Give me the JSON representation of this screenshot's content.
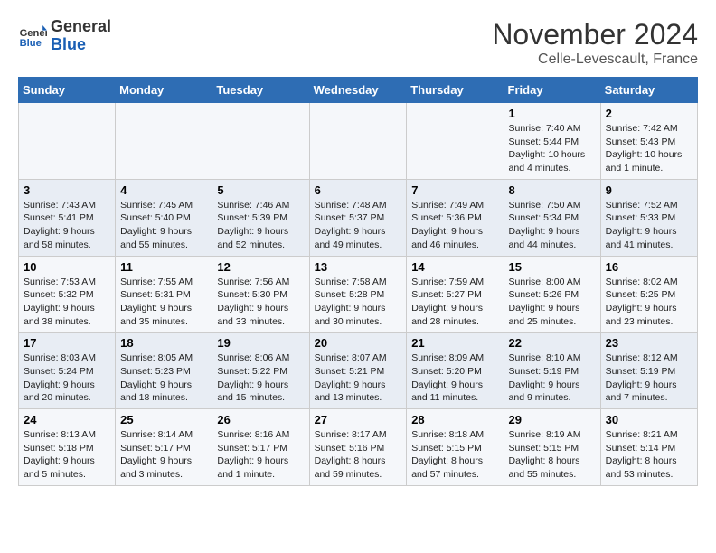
{
  "logo": {
    "text_general": "General",
    "text_blue": "Blue"
  },
  "title": "November 2024",
  "subtitle": "Celle-Levescault, France",
  "weekdays": [
    "Sunday",
    "Monday",
    "Tuesday",
    "Wednesday",
    "Thursday",
    "Friday",
    "Saturday"
  ],
  "weeks": [
    [
      {
        "day": "",
        "info": ""
      },
      {
        "day": "",
        "info": ""
      },
      {
        "day": "",
        "info": ""
      },
      {
        "day": "",
        "info": ""
      },
      {
        "day": "",
        "info": ""
      },
      {
        "day": "1",
        "info": "Sunrise: 7:40 AM\nSunset: 5:44 PM\nDaylight: 10 hours and 4 minutes."
      },
      {
        "day": "2",
        "info": "Sunrise: 7:42 AM\nSunset: 5:43 PM\nDaylight: 10 hours and 1 minute."
      }
    ],
    [
      {
        "day": "3",
        "info": "Sunrise: 7:43 AM\nSunset: 5:41 PM\nDaylight: 9 hours and 58 minutes."
      },
      {
        "day": "4",
        "info": "Sunrise: 7:45 AM\nSunset: 5:40 PM\nDaylight: 9 hours and 55 minutes."
      },
      {
        "day": "5",
        "info": "Sunrise: 7:46 AM\nSunset: 5:39 PM\nDaylight: 9 hours and 52 minutes."
      },
      {
        "day": "6",
        "info": "Sunrise: 7:48 AM\nSunset: 5:37 PM\nDaylight: 9 hours and 49 minutes."
      },
      {
        "day": "7",
        "info": "Sunrise: 7:49 AM\nSunset: 5:36 PM\nDaylight: 9 hours and 46 minutes."
      },
      {
        "day": "8",
        "info": "Sunrise: 7:50 AM\nSunset: 5:34 PM\nDaylight: 9 hours and 44 minutes."
      },
      {
        "day": "9",
        "info": "Sunrise: 7:52 AM\nSunset: 5:33 PM\nDaylight: 9 hours and 41 minutes."
      }
    ],
    [
      {
        "day": "10",
        "info": "Sunrise: 7:53 AM\nSunset: 5:32 PM\nDaylight: 9 hours and 38 minutes."
      },
      {
        "day": "11",
        "info": "Sunrise: 7:55 AM\nSunset: 5:31 PM\nDaylight: 9 hours and 35 minutes."
      },
      {
        "day": "12",
        "info": "Sunrise: 7:56 AM\nSunset: 5:30 PM\nDaylight: 9 hours and 33 minutes."
      },
      {
        "day": "13",
        "info": "Sunrise: 7:58 AM\nSunset: 5:28 PM\nDaylight: 9 hours and 30 minutes."
      },
      {
        "day": "14",
        "info": "Sunrise: 7:59 AM\nSunset: 5:27 PM\nDaylight: 9 hours and 28 minutes."
      },
      {
        "day": "15",
        "info": "Sunrise: 8:00 AM\nSunset: 5:26 PM\nDaylight: 9 hours and 25 minutes."
      },
      {
        "day": "16",
        "info": "Sunrise: 8:02 AM\nSunset: 5:25 PM\nDaylight: 9 hours and 23 minutes."
      }
    ],
    [
      {
        "day": "17",
        "info": "Sunrise: 8:03 AM\nSunset: 5:24 PM\nDaylight: 9 hours and 20 minutes."
      },
      {
        "day": "18",
        "info": "Sunrise: 8:05 AM\nSunset: 5:23 PM\nDaylight: 9 hours and 18 minutes."
      },
      {
        "day": "19",
        "info": "Sunrise: 8:06 AM\nSunset: 5:22 PM\nDaylight: 9 hours and 15 minutes."
      },
      {
        "day": "20",
        "info": "Sunrise: 8:07 AM\nSunset: 5:21 PM\nDaylight: 9 hours and 13 minutes."
      },
      {
        "day": "21",
        "info": "Sunrise: 8:09 AM\nSunset: 5:20 PM\nDaylight: 9 hours and 11 minutes."
      },
      {
        "day": "22",
        "info": "Sunrise: 8:10 AM\nSunset: 5:19 PM\nDaylight: 9 hours and 9 minutes."
      },
      {
        "day": "23",
        "info": "Sunrise: 8:12 AM\nSunset: 5:19 PM\nDaylight: 9 hours and 7 minutes."
      }
    ],
    [
      {
        "day": "24",
        "info": "Sunrise: 8:13 AM\nSunset: 5:18 PM\nDaylight: 9 hours and 5 minutes."
      },
      {
        "day": "25",
        "info": "Sunrise: 8:14 AM\nSunset: 5:17 PM\nDaylight: 9 hours and 3 minutes."
      },
      {
        "day": "26",
        "info": "Sunrise: 8:16 AM\nSunset: 5:17 PM\nDaylight: 9 hours and 1 minute."
      },
      {
        "day": "27",
        "info": "Sunrise: 8:17 AM\nSunset: 5:16 PM\nDaylight: 8 hours and 59 minutes."
      },
      {
        "day": "28",
        "info": "Sunrise: 8:18 AM\nSunset: 5:15 PM\nDaylight: 8 hours and 57 minutes."
      },
      {
        "day": "29",
        "info": "Sunrise: 8:19 AM\nSunset: 5:15 PM\nDaylight: 8 hours and 55 minutes."
      },
      {
        "day": "30",
        "info": "Sunrise: 8:21 AM\nSunset: 5:14 PM\nDaylight: 8 hours and 53 minutes."
      }
    ]
  ]
}
